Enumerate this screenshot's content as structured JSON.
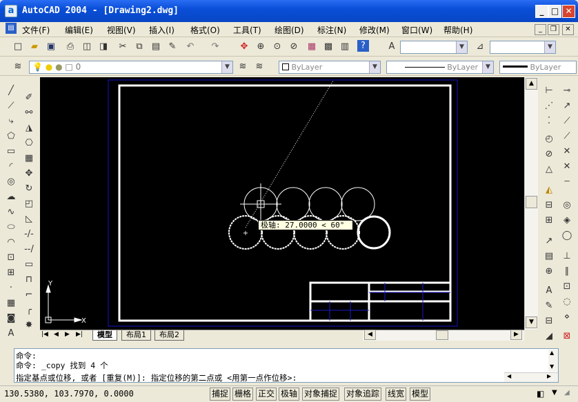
{
  "window": {
    "title": "AutoCAD 2004 - [Drawing2.dwg]",
    "app_icon": "a"
  },
  "menu": [
    "文件(F)",
    "编辑(E)",
    "视图(V)",
    "插入(I)",
    "格式(O)",
    "工具(T)",
    "绘图(D)",
    "标注(N)",
    "修改(M)",
    "窗口(W)",
    "帮助(H)"
  ],
  "layers": {
    "current_layer": "0",
    "color": "ByLayer",
    "linetype": "ByLayer",
    "lineweight": "ByLayer"
  },
  "canvas": {
    "tooltip": "极轴: 27.0000 < 60°",
    "ucs_x": "X",
    "ucs_y": "Y"
  },
  "tabs": [
    "模型",
    "布局1",
    "布局2"
  ],
  "command": {
    "line1": "命令:",
    "line2": "命令: _copy 找到 4 个",
    "line3": "指定基点或位移, 或者 [重复(M)]: 指定位移的第二点或 <用第一点作位移>:"
  },
  "status": {
    "coords": "130.5380, 103.7970, 0.0000",
    "buttons": [
      "捕捉",
      "栅格",
      "正交",
      "极轴",
      "对象捕捉",
      "对象追踪",
      "线宽",
      "模型"
    ]
  }
}
